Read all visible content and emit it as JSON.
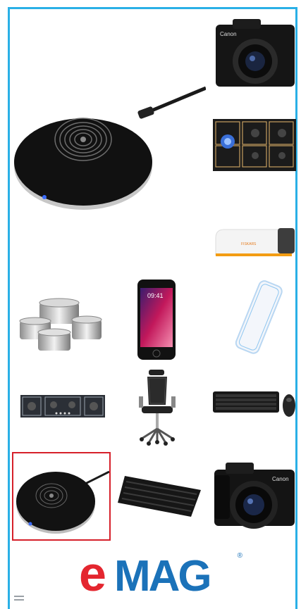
{
  "brand": {
    "logo_e": "e",
    "logo_rest": "MAG",
    "registered": "®"
  },
  "products": [
    {
      "icon": "wireless-charger-large"
    },
    {
      "icon": "mirrorless-camera"
    },
    {
      "icon": "gas-hob"
    },
    {
      "icon": "knife-sharpener"
    },
    {
      "icon": "cookware-set"
    },
    {
      "icon": "smartphone",
      "screen_time": "09:41"
    },
    {
      "icon": "power-bank"
    },
    {
      "icon": "gas-hob-long"
    },
    {
      "icon": "office-chair"
    },
    {
      "icon": "keyboard-mouse-combo"
    },
    {
      "icon": "wireless-charger-selected"
    },
    {
      "icon": "illuminated-keyboard"
    },
    {
      "icon": "camera-with-lens"
    }
  ],
  "colors": {
    "frame": "#2ab0e6",
    "selection": "#d6202a",
    "emag_red": "#e4262f",
    "emag_blue": "#1b72b9"
  }
}
